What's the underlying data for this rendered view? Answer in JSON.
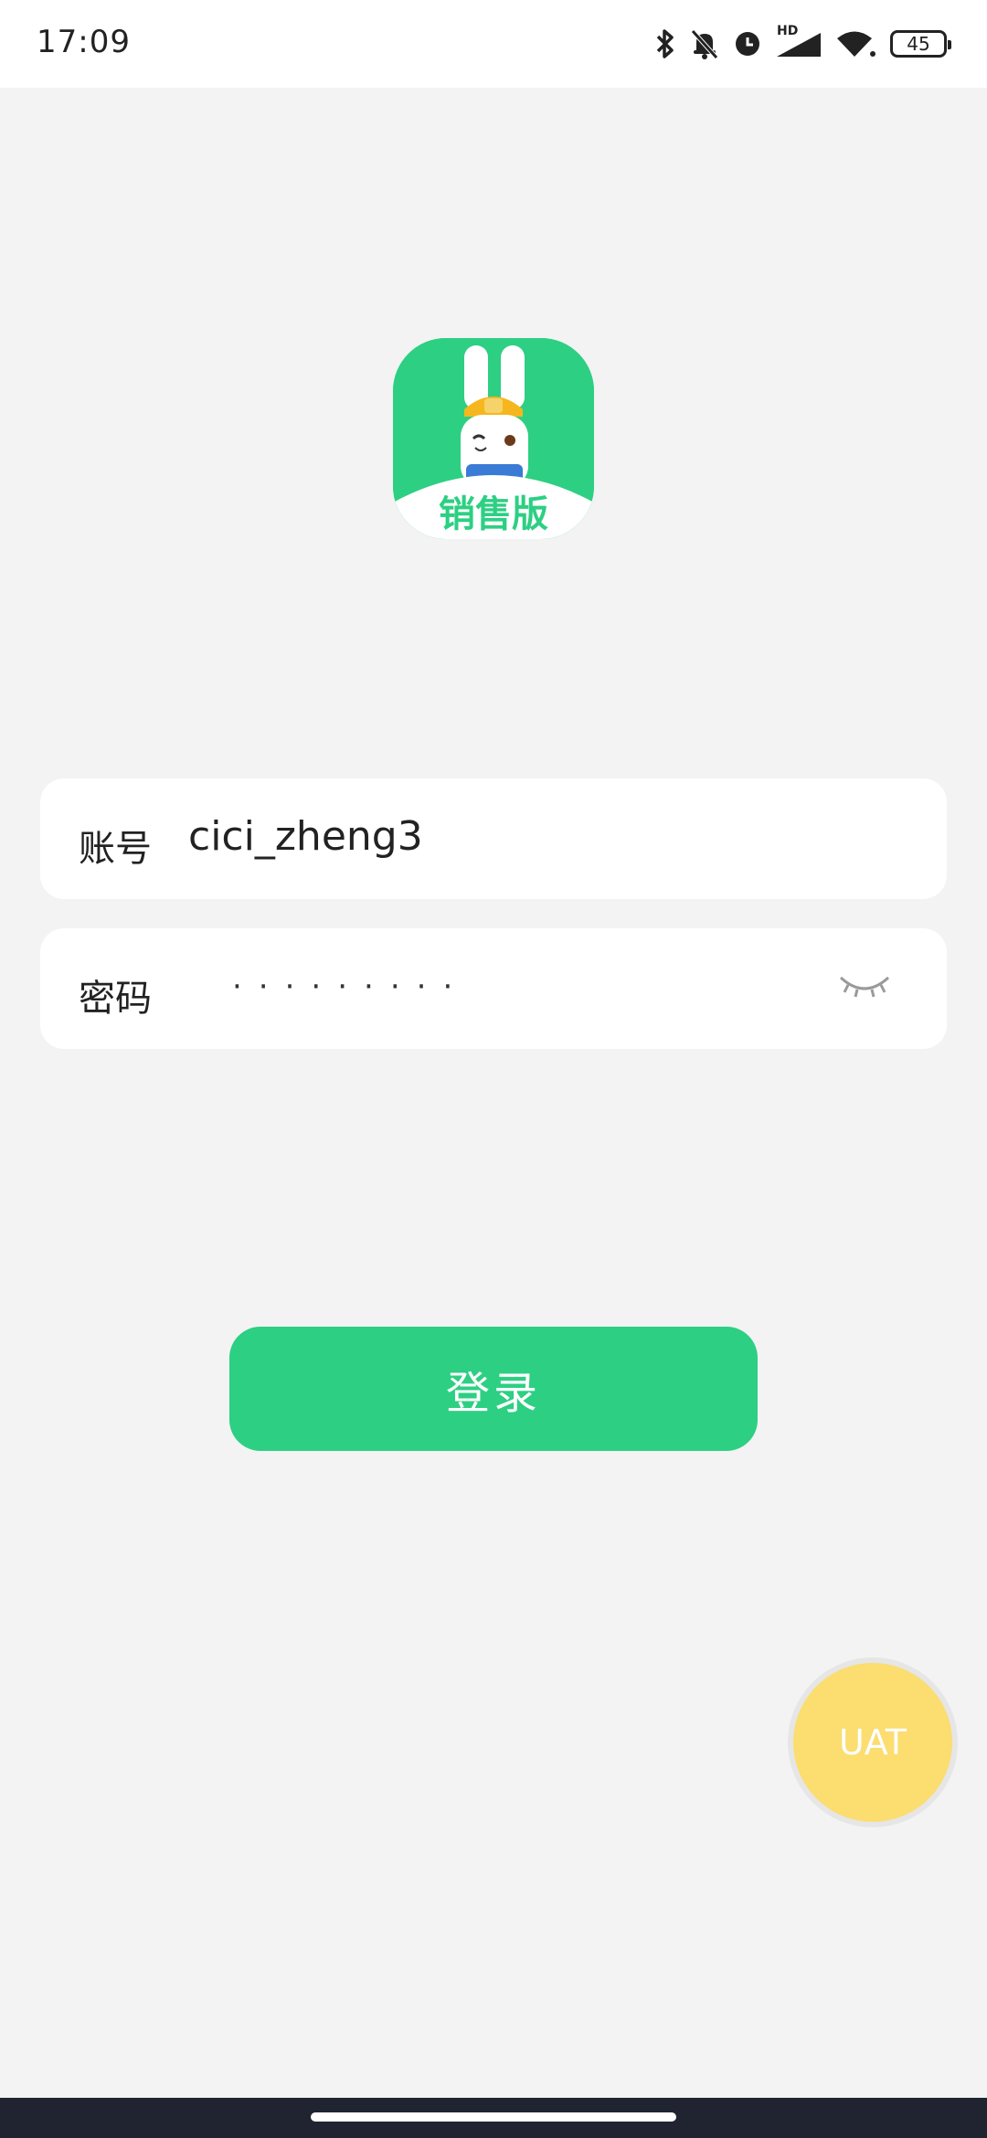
{
  "status_bar": {
    "time": "17:09",
    "network_badge": "HD",
    "battery_level": "45",
    "icons": [
      "bluetooth-icon",
      "mute-bell-icon",
      "alarm-clock-icon",
      "signal-icon",
      "wifi-icon",
      "battery-icon"
    ]
  },
  "logo": {
    "icon": "rabbit-mascot-logo",
    "caption": "销售版",
    "bg_color": "#2dcf83"
  },
  "form": {
    "account": {
      "label": "账号",
      "value": "cici_zheng3"
    },
    "password": {
      "label": "密码",
      "masked_value": "·········",
      "toggle_icon": "eye-closed-icon"
    }
  },
  "login_button": {
    "label": "登录",
    "color": "#2dcf83"
  },
  "env_badge": {
    "label": "UAT",
    "color": "#fcdc6a"
  }
}
